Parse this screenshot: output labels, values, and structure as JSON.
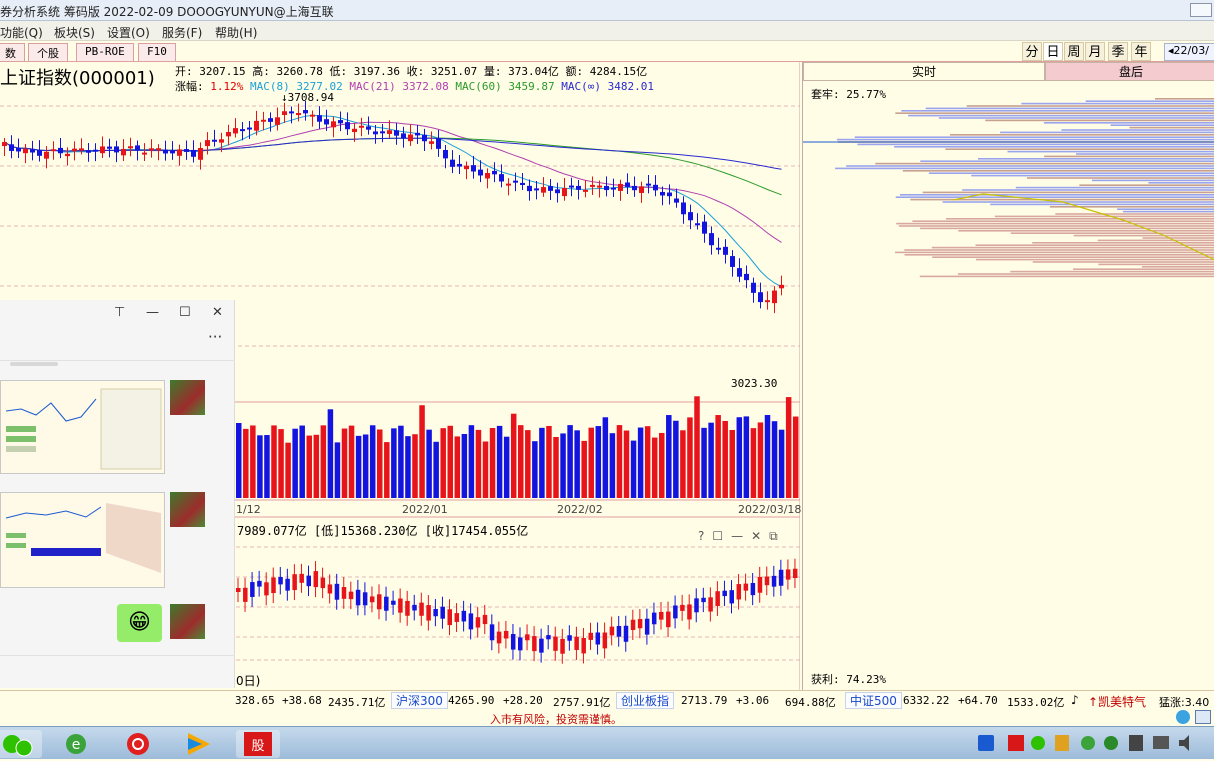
{
  "titlebar": {
    "title": "券分析系统 筹码版 2022-02-09 DOOOGYUNYUN@上海互联"
  },
  "menu": [
    "功能(Q)",
    "板块(S)",
    "设置(O)",
    "服务(F)",
    "帮助(H)"
  ],
  "tabs": [
    "数",
    "个股",
    "PB-ROE",
    "F10"
  ],
  "periods": [
    "分",
    "日",
    "周",
    "月",
    "季",
    "年"
  ],
  "active_period": "日",
  "date_button": "◂22/03/",
  "chart": {
    "index_name": "上证指数(000001)",
    "ohlc_line": "开: 3207.15 高: 3260.78 低: 3197.36 收: 3251.07 量: 373.04亿 额: 4284.15亿",
    "change_label": "涨幅:",
    "change_value": "1.12%",
    "mac": [
      {
        "label": "MAC(8)",
        "value": "3277.02",
        "color": "#1aa0d8"
      },
      {
        "label": "MAC(21)",
        "value": "3372.08",
        "color": "#b040b0"
      },
      {
        "label": "MAC(60)",
        "value": "3459.87",
        "color": "#2a9a2a"
      },
      {
        "label": "MAC(∞)",
        "value": "3482.01",
        "color": "#2a2ad0"
      }
    ],
    "high_marker": "3708.94",
    "low_marker": "3023.30",
    "date_labels": [
      "1/12",
      "2022/01",
      "2022/02",
      "2022/03/18"
    ],
    "lower_panel_text": "7989.077亿 [低]15368.230亿 [收]17454.055亿",
    "lower_panel_bottom_label": "0日)"
  },
  "right_pane": {
    "tab_realtime": "实时",
    "tab_after": "盘后",
    "trapped": "套牢: 25.77%",
    "profit": "获利: 74.23%"
  },
  "statusbar": {
    "items": [
      {
        "type": "value",
        "text": "328.65"
      },
      {
        "type": "value",
        "text": "+38.68"
      },
      {
        "type": "value",
        "text": "2435.71亿"
      },
      {
        "type": "button",
        "text": "沪深300"
      },
      {
        "type": "value",
        "text": "4265.90"
      },
      {
        "type": "value",
        "text": "+28.20"
      },
      {
        "type": "value",
        "text": "2757.91亿"
      },
      {
        "type": "button",
        "text": "创业板指"
      },
      {
        "type": "value",
        "text": "2713.79"
      },
      {
        "type": "value",
        "text": "+3.06"
      },
      {
        "type": "value",
        "text": "694.88亿"
      },
      {
        "type": "button",
        "text": "中证500"
      },
      {
        "type": "value",
        "text": "6332.22"
      },
      {
        "type": "value",
        "text": "+64.70"
      },
      {
        "type": "value",
        "text": "1533.02亿"
      }
    ],
    "news": "↑凯美特气",
    "news_extra": "猛涨:3.40"
  },
  "warning": "入市有风险，投资需谨慎。",
  "colors": {
    "up": "#e8141c",
    "down": "#1414e0",
    "bg": "#fffde6"
  },
  "taskbar": {
    "apps": [
      "wechat-icon",
      "ie-icon",
      "netease-music-icon",
      "media-player-icon",
      "stock-app-icon"
    ],
    "tray": [
      "ime-icon",
      "stock-tray-icon",
      "chat-tray-icon",
      "color-tray-icon",
      "security-icon",
      "shield-icon",
      "user-icon",
      "network-icon",
      "volume-icon"
    ]
  },
  "popup": {
    "pin": "⊤",
    "minimize": "—",
    "maximize": "☐",
    "close": "✕",
    "more": "···",
    "emoji": "😁"
  }
}
